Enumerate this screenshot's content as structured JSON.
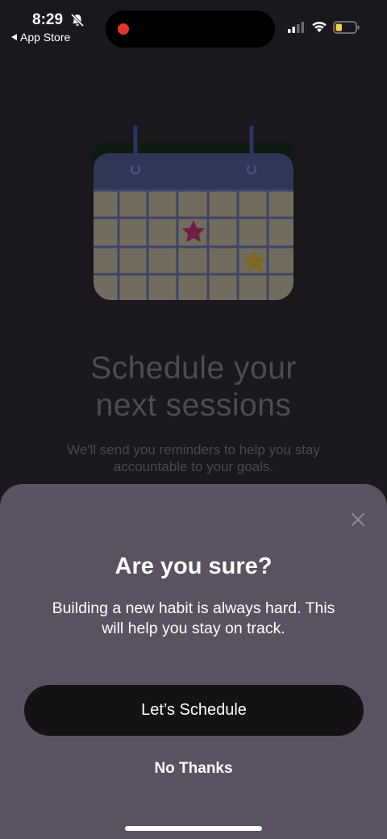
{
  "status_bar": {
    "time": "8:29",
    "back_app_label": "App Store",
    "icons": [
      "bell-off-icon",
      "signal-icon",
      "wifi-icon",
      "battery-icon"
    ],
    "recording_color": "#e5342f",
    "battery_color": "#f4d03f"
  },
  "background": {
    "title_line1": "Schedule your",
    "title_line2": "next sessions",
    "subtitle_line1": "We'll send you reminders to help you stay",
    "subtitle_line2": "accountable to your goals."
  },
  "sheet": {
    "title": "Are you sure?",
    "body_line1": "Building a new habit is always hard. This",
    "body_line2": "will help you stay on track.",
    "primary_button": "Let’s Schedule",
    "secondary_button": "No Thanks",
    "close_icon": "close-icon",
    "background_color": "#5a5260",
    "primary_button_color": "#141215"
  }
}
